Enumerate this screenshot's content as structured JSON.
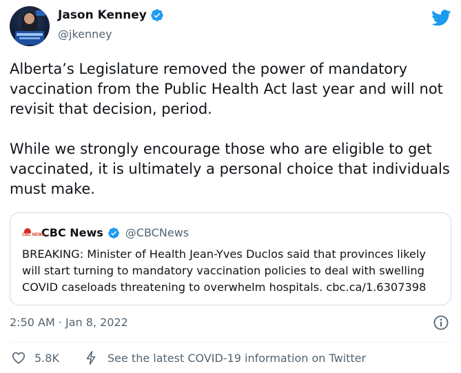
{
  "author": {
    "display_name": "Jason Kenney",
    "handle": "@jkenney",
    "avatar_icon": "profile-photo",
    "verified": true
  },
  "brand_icon": "twitter-bird-icon",
  "tweet": {
    "paragraphs": [
      "Alberta’s Legislature removed the power of mandatory vaccination from the Public Health Act last year and will not revisit that decision, period.",
      "While we strongly encourage those who are eligible to get vaccinated, it is ultimately a personal choice that individuals must make."
    ]
  },
  "quoted_tweet": {
    "logo_text": "CBC NEWS",
    "display_name": "CBC News",
    "handle": "@CBCNews",
    "verified": true,
    "text": "BREAKING: Minister of Health Jean-Yves Duclos said that provinces likely will start turning to mandatory vaccination policies to deal with swelling COVID caseloads threatening to overwhelm hospitals. cbc.ca/1.6307398"
  },
  "timestamp": "2:50 AM · Jan 8, 2022",
  "actions": {
    "like_count": "5.8K",
    "covid_link": "See the latest COVID-19 information on Twitter"
  },
  "colors": {
    "twitter_blue": "#1d9bf0",
    "text_primary": "#0f1419",
    "text_secondary": "#536471",
    "border": "#cfd9de"
  }
}
